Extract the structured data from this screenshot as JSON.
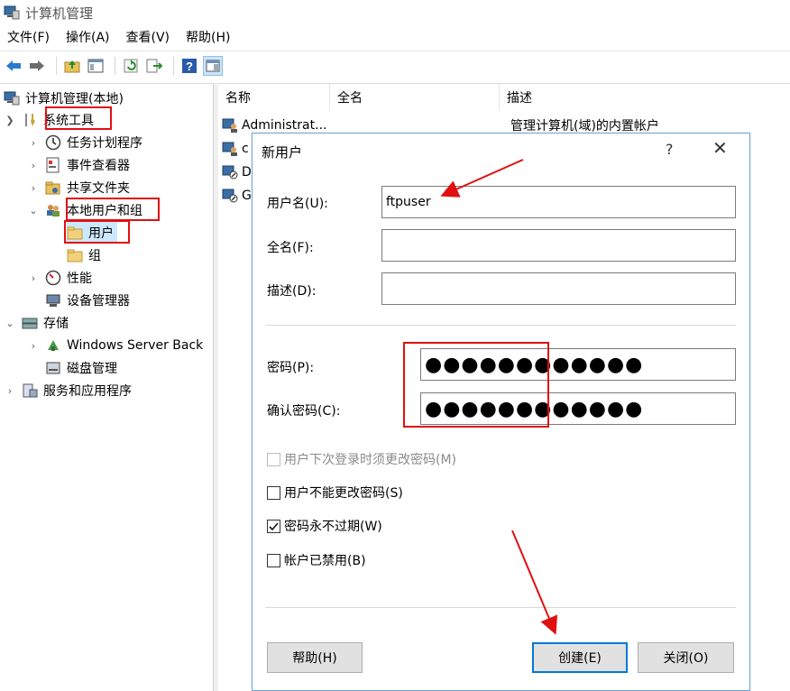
{
  "window": {
    "title": "计算机管理"
  },
  "menu": [
    "文件(F)",
    "操作(A)",
    "查看(V)",
    "帮助(H)"
  ],
  "toolbar": {
    "buttons": [
      "back-icon",
      "forward-icon",
      "up-folder-icon",
      "show-hide-tree-icon",
      "refresh-icon",
      "export-list-icon",
      "help-icon",
      "show-hide-action-pane-icon"
    ]
  },
  "tree": {
    "root": "计算机管理(本地)",
    "system_tools": "系统工具",
    "task_scheduler": "任务计划程序",
    "event_viewer": "事件查看器",
    "shared_folders": "共享文件夹",
    "local_users_groups": "本地用户和组",
    "users": "用户",
    "groups": "组",
    "performance": "性能",
    "device_manager": "设备管理器",
    "storage": "存储",
    "windows_server_backup": "Windows Server Back",
    "disk_management": "磁盘管理",
    "services_apps": "服务和应用程序"
  },
  "list": {
    "columns": [
      "名称",
      "全名",
      "描述"
    ],
    "rows": [
      {
        "name": "Administrat...",
        "fullname": "",
        "description": "管理计算机(域)的内置帐户"
      },
      {
        "name": "c",
        "fullname": "",
        "description": ""
      },
      {
        "name": "D",
        "fullname": "",
        "description": ""
      },
      {
        "name": "G",
        "fullname": "",
        "description": ""
      }
    ]
  },
  "dialog": {
    "title": "新用户",
    "help": "?",
    "close": "✕",
    "username_label": "用户名(U):",
    "username_value": "ftpuser",
    "fullname_label": "全名(F):",
    "fullname_value": "",
    "description_label": "描述(D):",
    "description_value": "",
    "password_label": "密码(P):",
    "password_value": "●●●●●●●●●●●●",
    "confirm_label": "确认密码(C):",
    "confirm_value": "●●●●●●●●●●●●",
    "chk_must_change": {
      "label": "用户下次登录时须更改密码(M)",
      "checked": false,
      "disabled": true
    },
    "chk_cannot_change": {
      "label": "用户不能更改密码(S)",
      "checked": false
    },
    "chk_never_expires": {
      "label": "密码永不过期(W)",
      "checked": true
    },
    "chk_disabled": {
      "label": "帐户已禁用(B)",
      "checked": false
    },
    "help_button": "帮助(H)",
    "create_button": "创建(E)",
    "close_button": "关闭(O)"
  },
  "annotation_color": "#e01010"
}
